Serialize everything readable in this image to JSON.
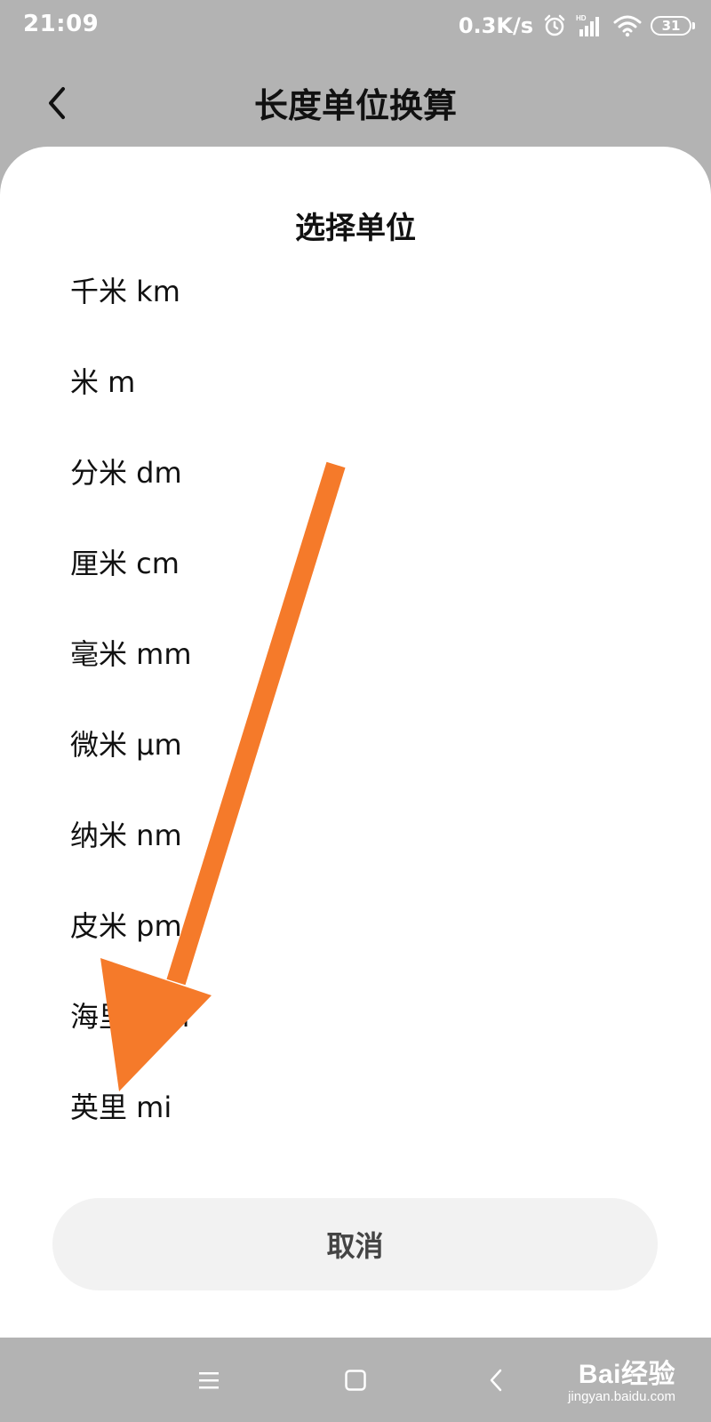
{
  "status_bar": {
    "time": "21:09",
    "network_speed": "0.3K/s",
    "hd_label": "HD",
    "battery_level": "31",
    "icons": [
      "alarm-icon",
      "signal-icon",
      "wifi-icon",
      "battery-icon"
    ]
  },
  "header": {
    "title": "长度单位换算",
    "back_icon": "chevron-left-icon"
  },
  "dialog": {
    "title": "选择单位",
    "units": [
      {
        "label": "千米 km"
      },
      {
        "label": "米 m"
      },
      {
        "label": "分米 dm"
      },
      {
        "label": "厘米 cm"
      },
      {
        "label": "毫米 mm"
      },
      {
        "label": "微米 μm"
      },
      {
        "label": "纳米 nm"
      },
      {
        "label": "皮米 pm"
      },
      {
        "label": "海里 nmi"
      },
      {
        "label": "英里 mi"
      }
    ],
    "cancel_label": "取消"
  },
  "annotation": {
    "arrow_color": "#f57a2a",
    "arrow_icon": "arrow-down-left-icon"
  },
  "nav_bar": {
    "icons": [
      "menu-icon",
      "home-icon",
      "back-icon"
    ]
  },
  "watermark": {
    "logo": "Bai经验",
    "url": "jingyan.baidu.com"
  },
  "colors": {
    "background_dim": "#b3b3b3",
    "sheet": "#ffffff",
    "cancel_bg": "#f2f2f2"
  }
}
